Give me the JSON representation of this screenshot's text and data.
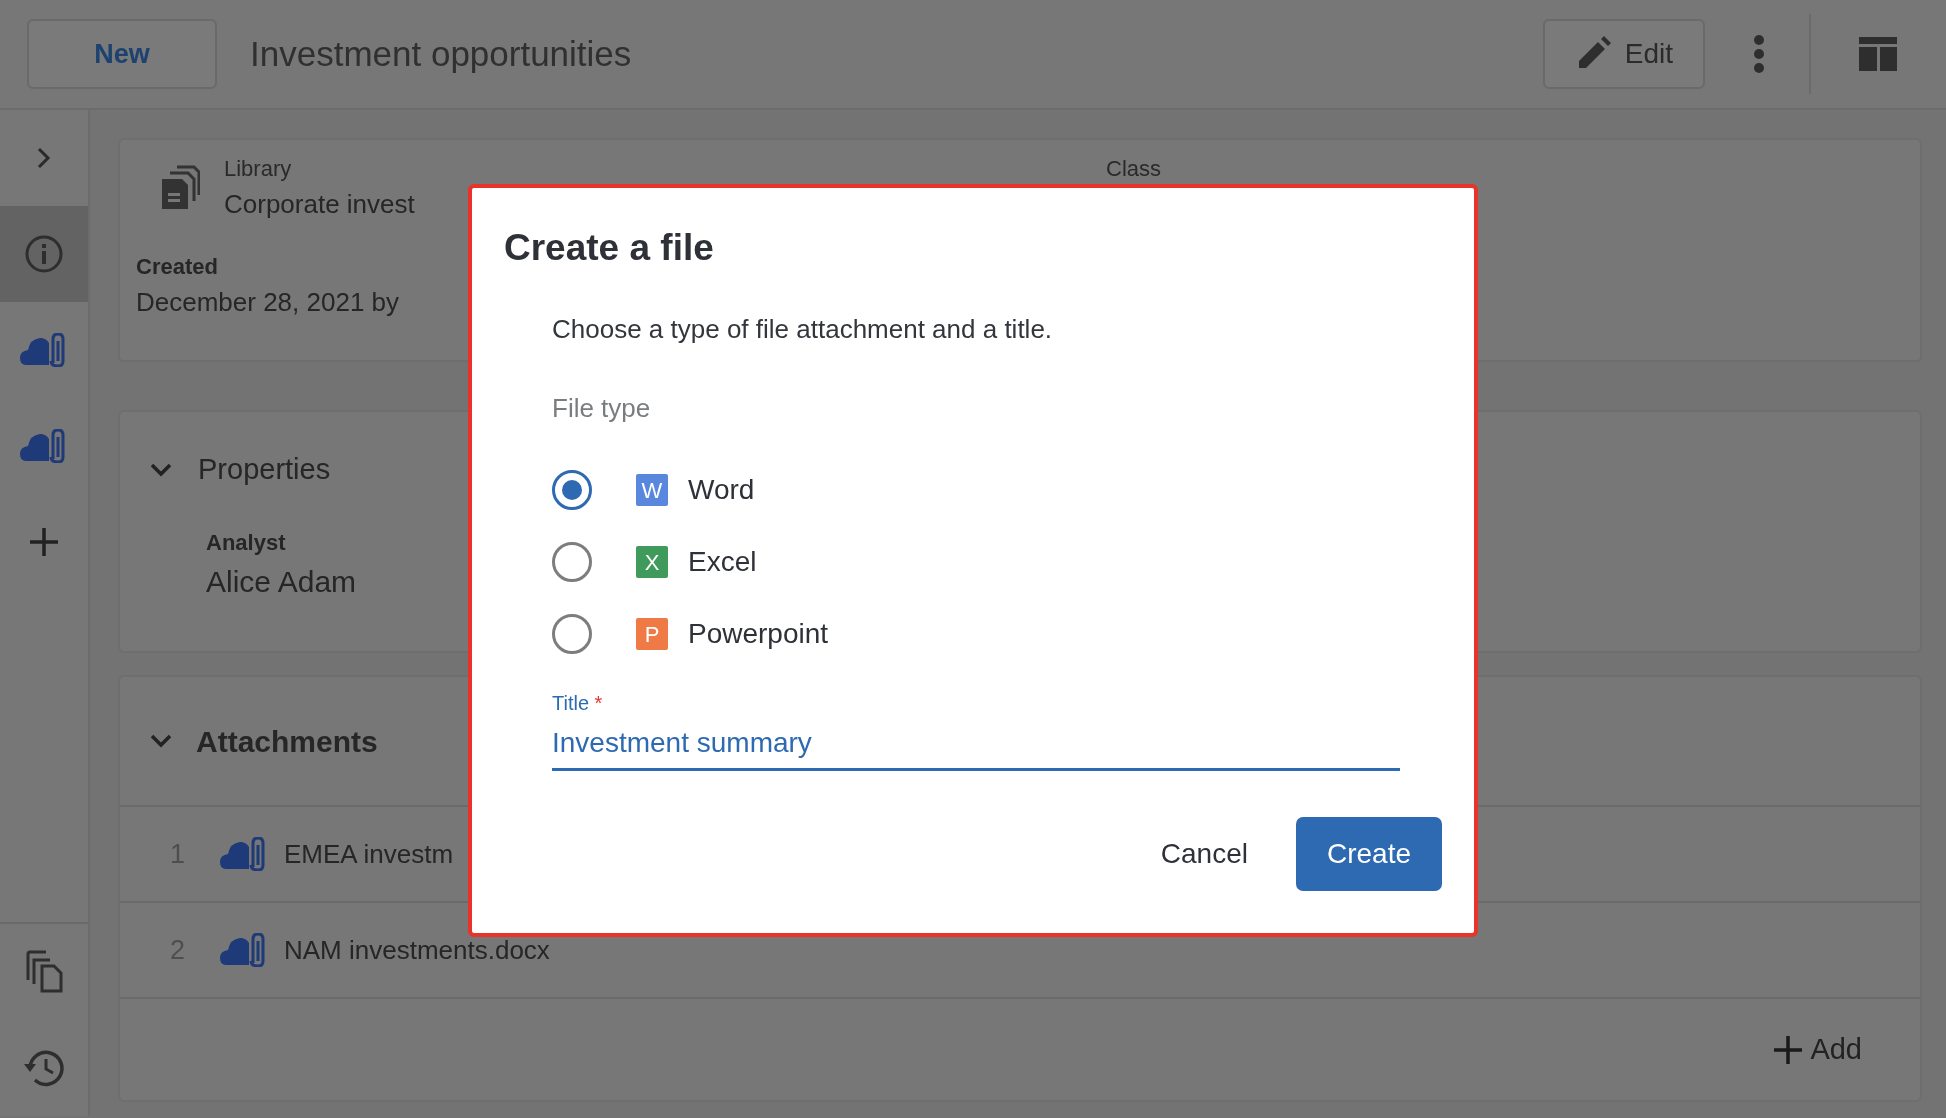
{
  "header": {
    "new_button": "New",
    "title": "Investment opportunities",
    "edit_button": "Edit"
  },
  "sidebar": {
    "items": [
      {
        "kind": "expand",
        "selected": false
      },
      {
        "kind": "info",
        "selected": true
      },
      {
        "kind": "attachment",
        "selected": false
      },
      {
        "kind": "attachment",
        "selected": false
      },
      {
        "kind": "add",
        "selected": false
      }
    ],
    "bottom_items": [
      {
        "kind": "copy"
      },
      {
        "kind": "history"
      }
    ]
  },
  "summary": {
    "library": {
      "label": "Library",
      "value": "Corporate invest"
    },
    "class": {
      "label": "Class"
    },
    "created": {
      "label": "Created",
      "value": "December 28, 2021 by"
    }
  },
  "properties": {
    "title": "Properties",
    "expanded": true,
    "fields": [
      {
        "label": "Analyst",
        "value": "Alice Adam"
      }
    ]
  },
  "attachments": {
    "title": "Attachments",
    "expanded": true,
    "rows": [
      {
        "number": "1",
        "name": "EMEA investm"
      },
      {
        "number": "2",
        "name": "NAM investments.docx"
      }
    ],
    "add_button": "Add"
  },
  "dialog": {
    "title": "Create a file",
    "description": "Choose a type of file attachment and a title.",
    "file_type_label": "File type",
    "file_types": [
      {
        "kind": "word",
        "letter": "W",
        "label": "Word",
        "selected": true
      },
      {
        "kind": "excel",
        "letter": "X",
        "label": "Excel",
        "selected": false
      },
      {
        "kind": "powerpoint",
        "letter": "P",
        "label": "Powerpoint",
        "selected": false
      }
    ],
    "title_field": {
      "label": "Title",
      "required_mark": "*",
      "value": "Investment summary"
    },
    "buttons": [
      {
        "kind": "secondary",
        "label": "Cancel"
      },
      {
        "kind": "primary",
        "label": "Create"
      }
    ]
  }
}
